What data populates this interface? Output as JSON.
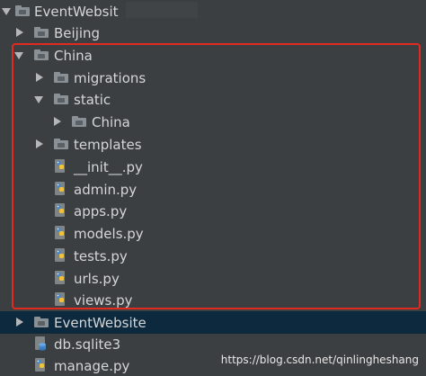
{
  "tree": {
    "root": {
      "label": "EventWebsit"
    },
    "beijing": {
      "label": "Beijing"
    },
    "china": {
      "label": "China"
    },
    "migrations": {
      "label": "migrations"
    },
    "static": {
      "label": "static"
    },
    "static_china": {
      "label": "China"
    },
    "templates": {
      "label": "templates"
    },
    "init": {
      "label": "__init__.py"
    },
    "admin": {
      "label": "admin.py"
    },
    "apps": {
      "label": "apps.py"
    },
    "models": {
      "label": "models.py"
    },
    "tests": {
      "label": "tests.py"
    },
    "urls": {
      "label": "urls.py"
    },
    "views": {
      "label": "views.py"
    },
    "eventwebsite": {
      "label": "EventWebsite"
    },
    "db": {
      "label": "db.sqlite3"
    },
    "manage": {
      "label": "manage.py"
    }
  },
  "watermark": "https://blog.csdn.net/qinlingheshang",
  "colors": {
    "background": "#3c3f41",
    "selection": "#0d293e",
    "highlight_box": "#e02a22",
    "text": "#d4d6d8"
  }
}
